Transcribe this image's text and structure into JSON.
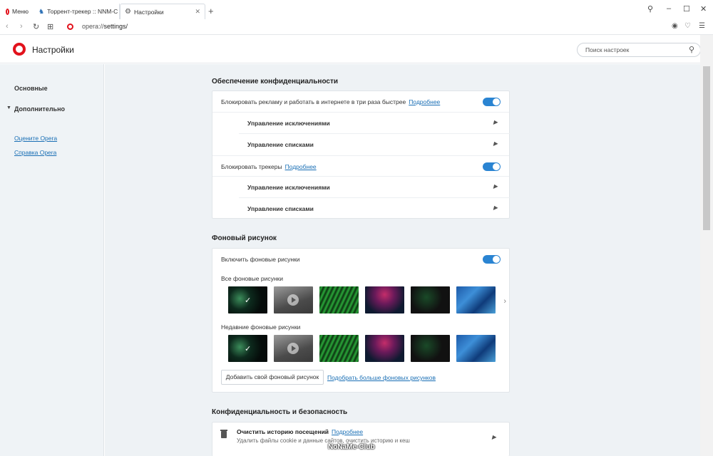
{
  "browser": {
    "menu_label": "Меню",
    "tabs": [
      {
        "title": "Торрент-трекер :: NNM-C"
      },
      {
        "title": "Настройки"
      }
    ],
    "new_tab": "+",
    "address": {
      "scheme": "opera://",
      "path": "settings/"
    }
  },
  "header": {
    "title": "Настройки",
    "search_placeholder": "Поиск настроек"
  },
  "sidebar": {
    "items": [
      {
        "label": "Основные"
      },
      {
        "label": "Дополнительно"
      }
    ],
    "links": [
      {
        "label": "Оцените Opera"
      },
      {
        "label": "Справка Opera"
      }
    ]
  },
  "privacy_section": {
    "title": "Обеспечение конфиденциальности",
    "ad_block": {
      "label": "Блокировать рекламу и работать в интернете в три раза быстрее",
      "link": "Подробнее",
      "enabled": true
    },
    "ad_exceptions": "Управление исключениями",
    "ad_lists": "Управление списками",
    "tracker_block": {
      "label": "Блокировать трекеры",
      "link": "Подробнее",
      "enabled": true
    },
    "tracker_exceptions": "Управление исключениями",
    "tracker_lists": "Управление списками"
  },
  "wallpaper_section": {
    "title": "Фоновый рисунок",
    "enable_label": "Включить фоновые рисунки",
    "enabled": true,
    "all_label": "Все фоновые рисунки",
    "recent_label": "Недавние фоновые рисунки",
    "selected_index": 0,
    "add_button": "Добавить свой фоновый рисунок",
    "more_link": "Подобрать больше фоновых рисунков"
  },
  "security_section": {
    "title": "Конфиденциальность и безопасность",
    "clear_history": {
      "title": "Очистить историю посещений",
      "link": "Подробнее",
      "subtitle": "Удалить файлы cookie и данные сайтов, очистить историю и кеш"
    }
  },
  "watermark": "NoNaMe-Club"
}
